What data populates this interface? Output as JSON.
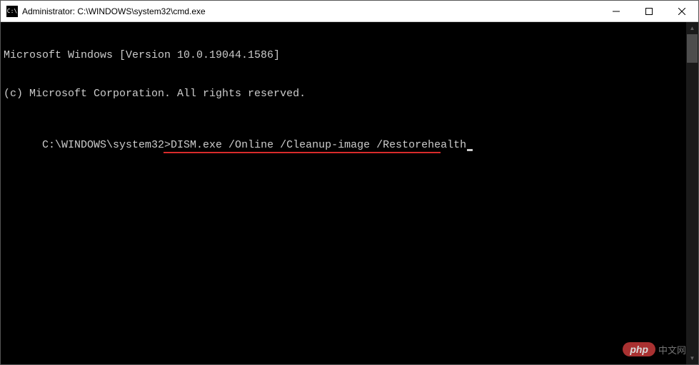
{
  "titlebar": {
    "icon_text": "C:\\",
    "title": "Administrator: C:\\WINDOWS\\system32\\cmd.exe"
  },
  "terminal": {
    "line1": "Microsoft Windows [Version 10.0.19044.1586]",
    "line2": "(c) Microsoft Corporation. All rights reserved.",
    "blank": "",
    "prompt": "C:\\WINDOWS\\system32>",
    "command": "DISM.exe /Online /Cleanup-image /Restorehealth"
  },
  "watermark": {
    "badge": "php",
    "text": "中文网"
  }
}
